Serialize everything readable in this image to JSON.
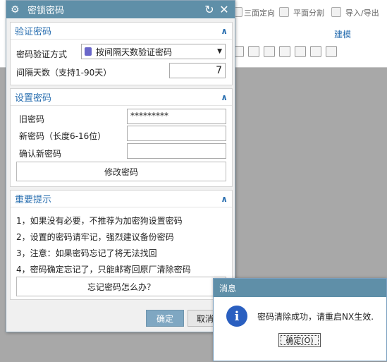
{
  "background": {
    "ribbon_items": [
      "三面定向",
      "平面分割",
      "导入/导出"
    ],
    "group_label": "建模"
  },
  "dialog": {
    "title": "密锁密码",
    "verify": {
      "heading": "验证密码",
      "method_label": "密码验证方式",
      "method_value": "按间隔天数验证密码",
      "days_label": "间隔天数（支持1-90天）",
      "days_value": "7"
    },
    "set": {
      "heading": "设置密码",
      "old_label": "旧密码",
      "old_value": "*********",
      "new_label": "新密码（长度6-16位）",
      "confirm_label": "确认新密码",
      "change_button": "修改密码"
    },
    "tips": {
      "heading": "重要提示",
      "lines": [
        "1，如果没有必要，不推荐为加密狗设置密码",
        "2，设置的密码请牢记，强烈建议备份密码",
        "3，注意：如果密码忘记了将无法找回",
        "4，密码确定忘记了，只能邮寄回原厂清除密码"
      ],
      "forgot_button": "忘记密码怎么办？"
    },
    "ok_button": "确定",
    "cancel_button": "取消"
  },
  "message": {
    "title": "消息",
    "text": "密码清除成功，请重启NX生效.",
    "ok_label": "确定(O)"
  },
  "colors": {
    "title_bar": "#5f8fa8",
    "section_heading": "#2a6fb0",
    "ok_button": "#7fa7c2"
  }
}
